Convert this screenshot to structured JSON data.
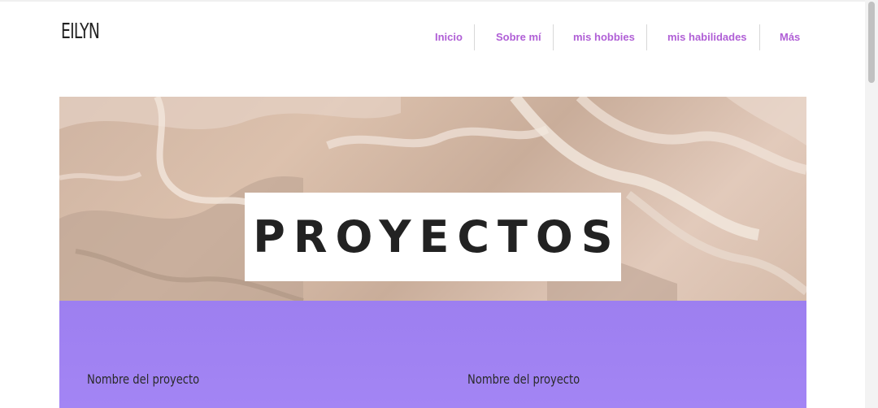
{
  "site": {
    "logo": "EILYN"
  },
  "nav": {
    "items": [
      "Inicio",
      "Sobre mí",
      "mis hobbies",
      "mis habilidades",
      "Más"
    ]
  },
  "hero": {
    "title": "PROYECTOS"
  },
  "projects": {
    "items": [
      {
        "label": "Nombre del proyecto"
      },
      {
        "label": "Nombre del proyecto"
      }
    ]
  },
  "colors": {
    "accent": "#b05fd6",
    "section_bg": "#a385f4"
  }
}
